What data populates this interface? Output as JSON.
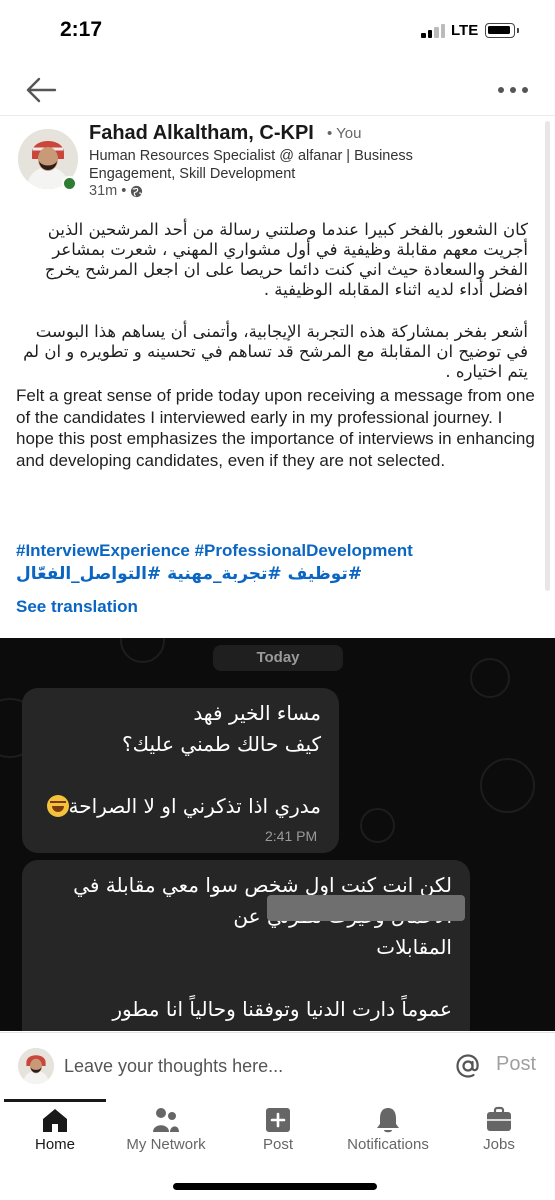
{
  "status_bar": {
    "time": "2:17",
    "network": "LTE"
  },
  "post": {
    "author_name": "Fahad Alkaltham, C-KPI",
    "author_badge": "• You",
    "headline": "Human Resources Specialist @ alfanar | Business Engagement, Skill Development",
    "time_ago": "31m •",
    "arabic_paragraph_1": "كان الشعور بالفخر كبيرا عندما وصلتني رسالة من أحد المرشحين الذين أجريت معهم مقابلة وظيفية في أول مشواري المهني ، شعرت بمشاعر الفخر والسعادة حيث اني كنت دائما حريصا على ان اجعل المرشح  يخرج افضل أداء لديه اثناء المقابله الوظيفية .",
    "arabic_paragraph_2": "أشعر بفخر بمشاركة هذه التجربة الإيجابية، وأتمنى أن يساهم هذا البوست في توضيح ان المقابلة مع المرشح قد تساهم في تحسينه و تطويره و ان لم يتم اختياره .",
    "english_paragraph": "Felt a great sense of pride today upon receiving a message from one of the candidates I interviewed early in my professional journey. I hope this post emphasizes the importance of interviews in enhancing and developing candidates, even if they are not selected.",
    "hashtags_line_1": "#InterviewExperience #ProfessionalDevelopment",
    "hashtags_line_2": "#توظيف #تجربة_مهنية #التواصل_الفعّال",
    "see_translation": "See translation"
  },
  "chat_image": {
    "date_pill": "Today",
    "bubble_1_lines": [
      "مساء الخير فهد",
      "كيف حالك طمني عليك؟",
      "",
      "مدري اذا تذكرني او لا الصراحة"
    ],
    "bubble_1_time": "2:41 PM",
    "bubble_2_lines": [
      "لكن انت كنت اول شخص سوا معي مقابلة في",
      "الاعمال وغيرت نظرتي عن",
      "المقابلات",
      "",
      "عموماً دارت الدنيا وتوفقنا وحالياً انا مطور"
    ]
  },
  "comment_bar": {
    "placeholder": "Leave your thoughts here...",
    "post_label": "Post"
  },
  "bottom_nav": {
    "items": [
      {
        "label": "Home",
        "icon": "home-icon",
        "active": true
      },
      {
        "label": "My Network",
        "icon": "network-icon",
        "active": false
      },
      {
        "label": "Post",
        "icon": "plus-square-icon",
        "active": false
      },
      {
        "label": "Notifications",
        "icon": "bell-icon",
        "active": false
      },
      {
        "label": "Jobs",
        "icon": "briefcase-icon",
        "active": false
      }
    ]
  },
  "colors": {
    "link_blue": "#0a66c2",
    "presence_green": "#2e7d32",
    "chat_bg": "#0c0c0c",
    "bubble_bg": "#262626"
  }
}
